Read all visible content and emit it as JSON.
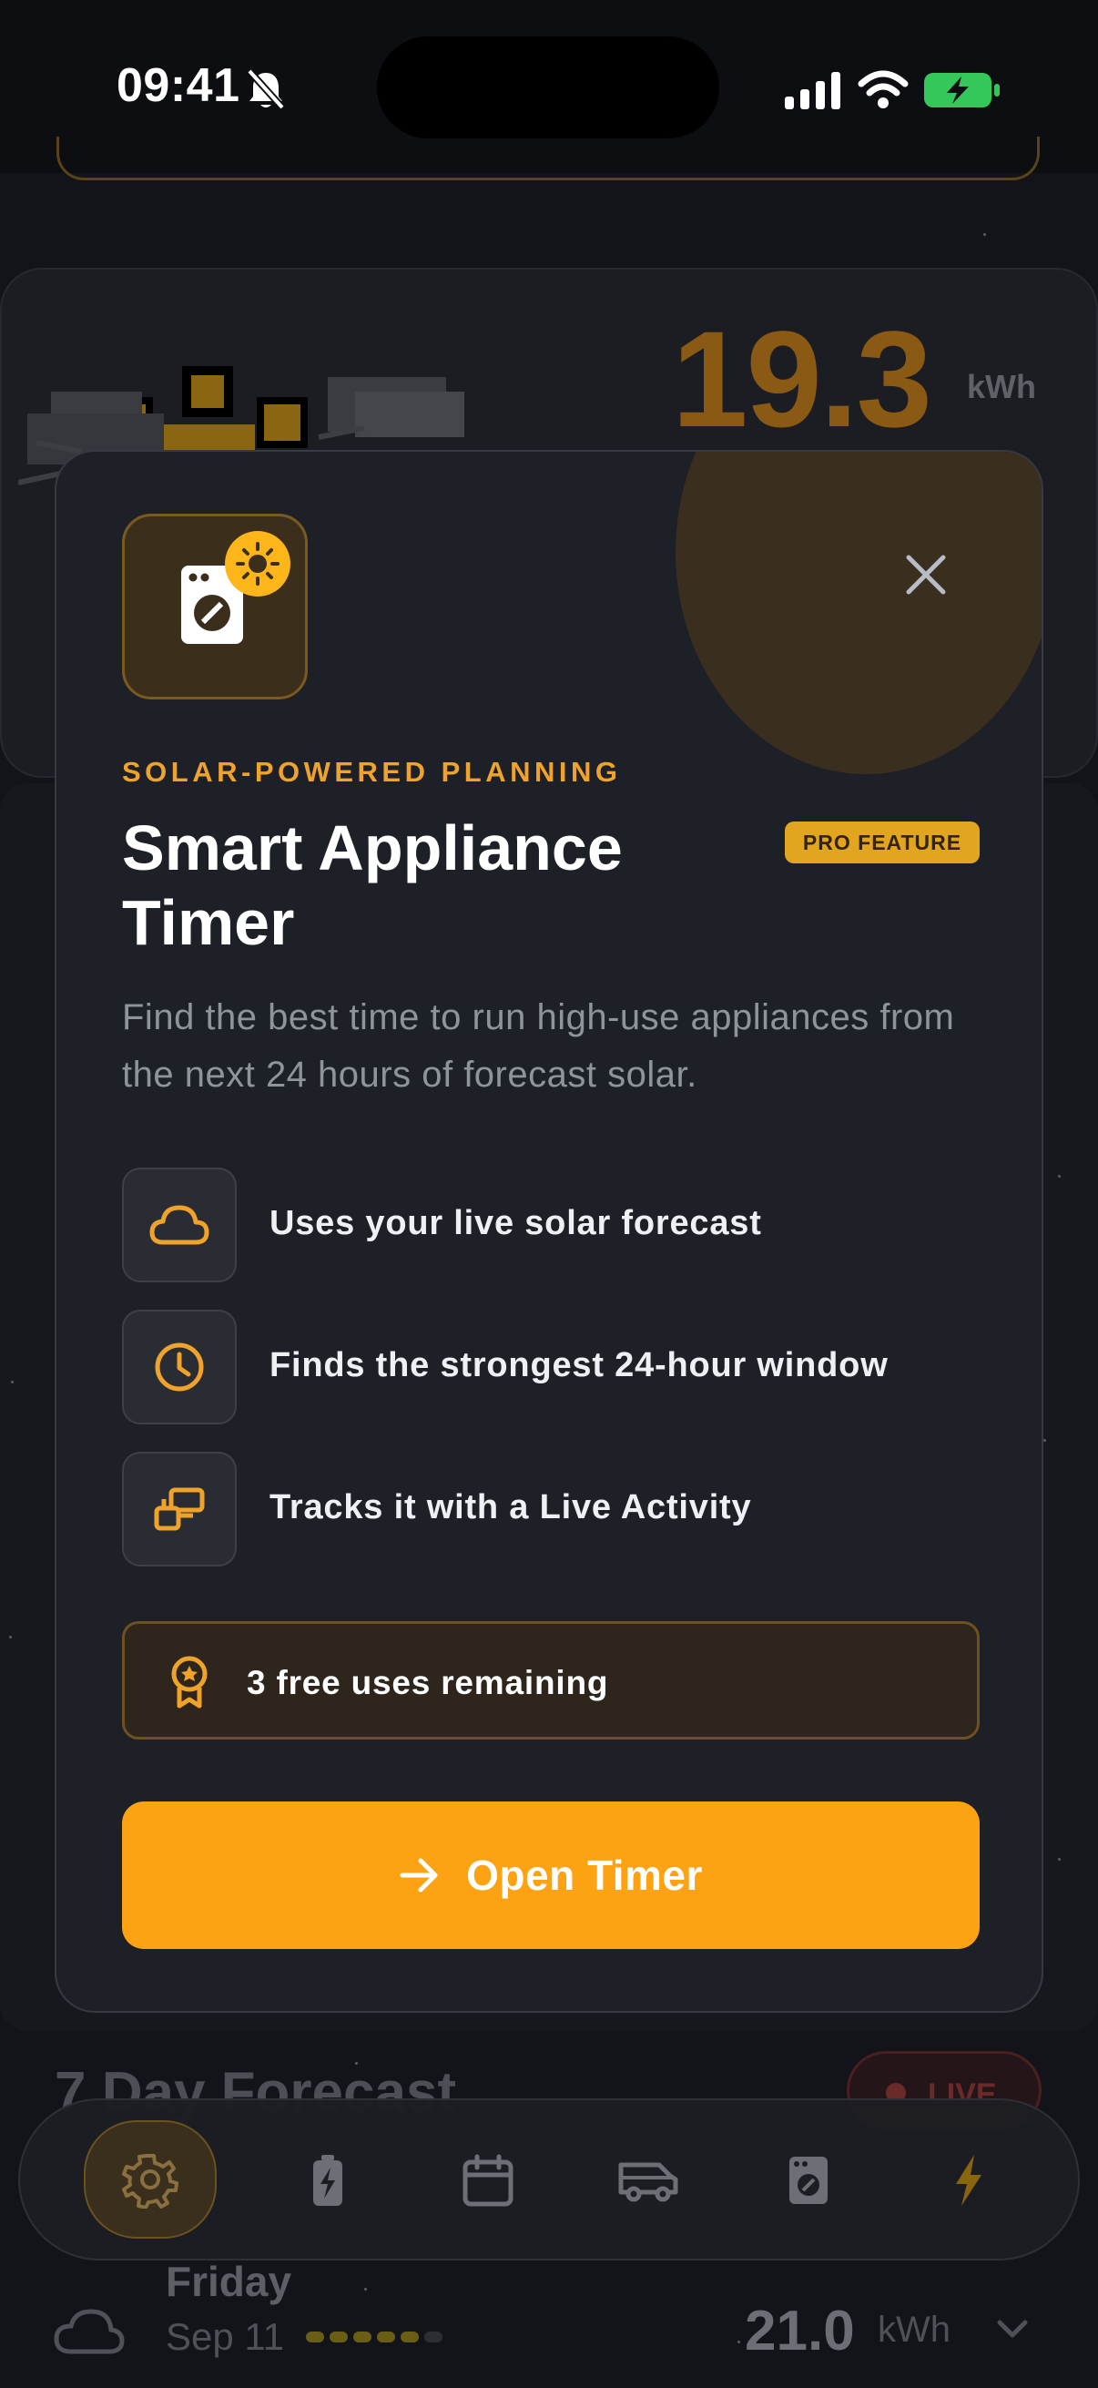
{
  "status_bar": {
    "time": "09:41"
  },
  "background": {
    "energy_value": "19.3",
    "energy_unit": "kWh",
    "forecast_title": "7 Day Forecast",
    "live_label": "LIVE",
    "day": {
      "name": "Friday",
      "date": "Sep 11",
      "value": "21.0",
      "unit": "kWh",
      "rating_filled": 5,
      "rating_total": 6
    }
  },
  "modal": {
    "eyebrow": "SOLAR-POWERED PLANNING",
    "title": "Smart Appliance Timer",
    "badge": "PRO FEATURE",
    "description": "Find the best time to run high-use appliances from the next 24 hours of forecast solar.",
    "features": [
      {
        "icon": "cloud-icon",
        "text": "Uses your live solar forecast"
      },
      {
        "icon": "clock-icon",
        "text": "Finds the strongest 24-hour window"
      },
      {
        "icon": "live-activity-icon",
        "text": "Tracks it with a Live Activity"
      }
    ],
    "uses_remaining": "3 free uses remaining",
    "cta_label": "Open Timer"
  },
  "tab_bar": {
    "tabs": [
      "gear-icon",
      "battery-icon",
      "calendar-icon",
      "van-icon",
      "washer-icon",
      "bolt-icon"
    ],
    "active_index": 0
  },
  "colors": {
    "accent": "#FDA213",
    "badge": "#E2A51F",
    "modal_bg": "#1E2027",
    "page_bg": "#121419"
  }
}
